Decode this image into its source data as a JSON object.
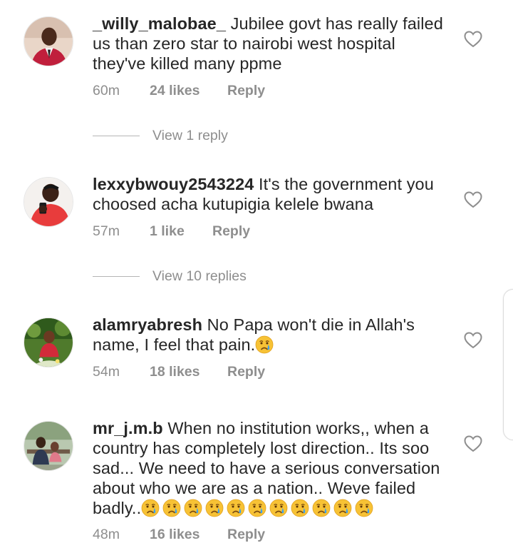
{
  "comments": [
    {
      "username": "_willy_malobae_",
      "text": " Jubilee govt has really failed us than zero star to nairobi west hospital they've killed many ppme",
      "time": "60m",
      "likes": "24 likes",
      "reply": "Reply",
      "view_replies": "View 1 reply"
    },
    {
      "username": "lexxybwouy2543224",
      "text": " It's the government you choosed acha kutupigia kelele bwana",
      "time": "57m",
      "likes": "1 like",
      "reply": "Reply",
      "view_replies": "View 10 replies"
    },
    {
      "username": "alamryabresh",
      "text": " No Papa won't die in Allah's name, I feel that pain.",
      "time": "54m",
      "likes": "18 likes",
      "reply": "Reply"
    },
    {
      "username": "mr_j.m.b",
      "text": " When no institution works,, when a country has completely lost direction.. Its soo sad... We need to have a serious conversation about who we are as a nation.. Weve failed badly..",
      "time": "48m",
      "likes": "16 likes",
      "reply": "Reply"
    }
  ],
  "icons": {
    "like": "heart-outline-icon",
    "emoji": "crying-face-emoji"
  },
  "colors": {
    "text": "#262626",
    "meta": "#8e8e8e",
    "divider": "#b5b5b5"
  }
}
